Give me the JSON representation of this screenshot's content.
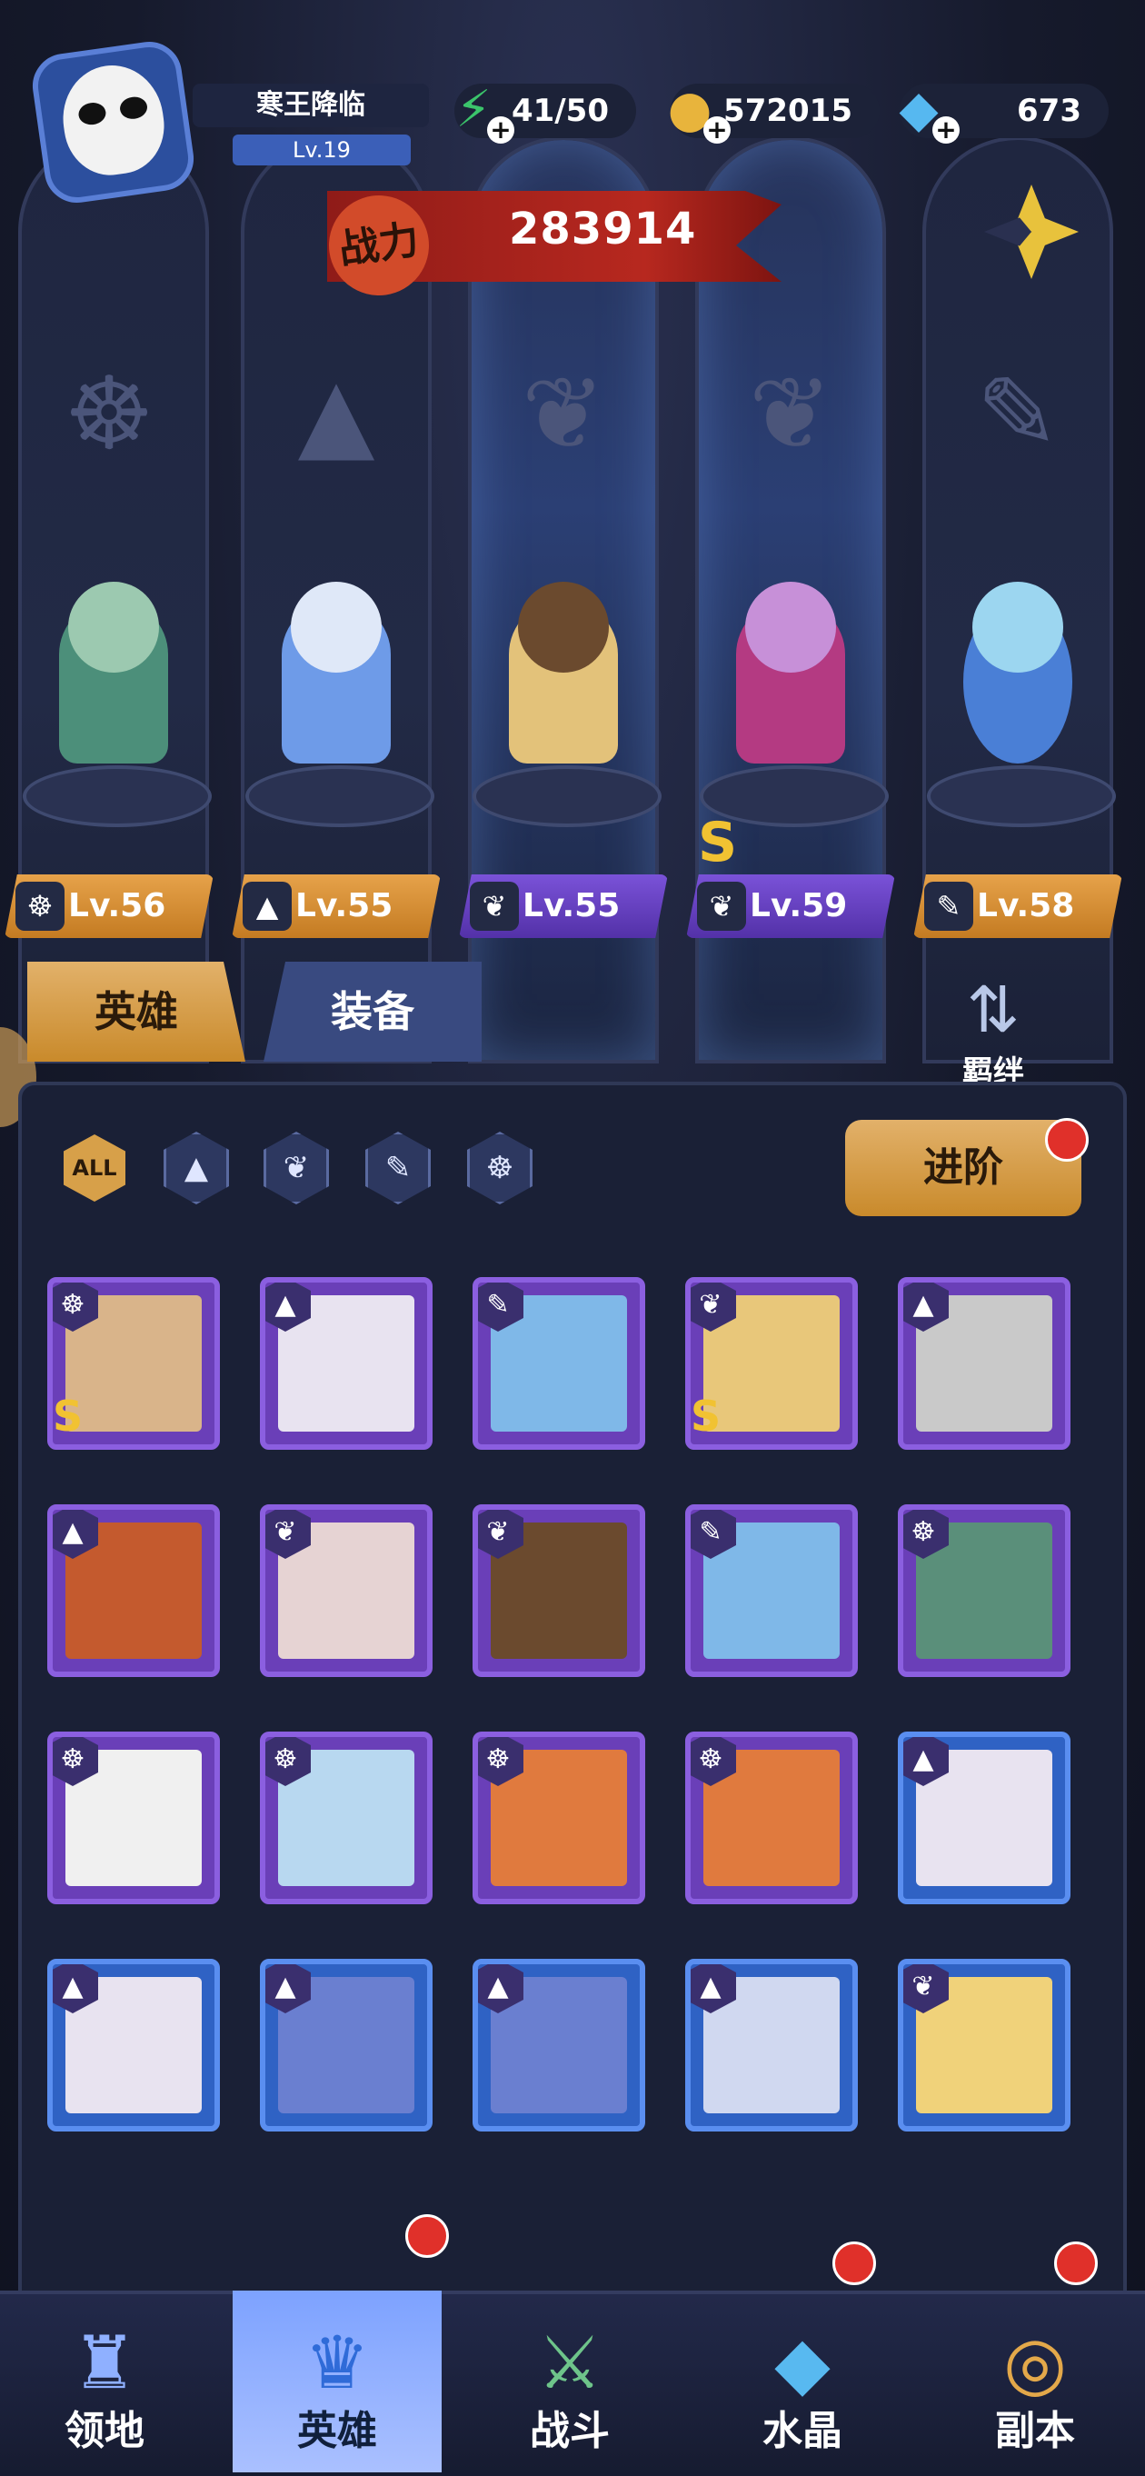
{
  "player": {
    "name": "寒王降临",
    "level": "Lv.19"
  },
  "resources": {
    "energy": "41/50",
    "gold": "572015",
    "diamonds": "673"
  },
  "power": {
    "label": "战力",
    "value": "283914"
  },
  "team": [
    {
      "level": "Lv.56",
      "tag_color": "gold",
      "class_icon": "beast-class-icon"
    },
    {
      "level": "Lv.55",
      "tag_color": "gold",
      "class_icon": "mage-class-icon"
    },
    {
      "level": "Lv.55",
      "tag_color": "purple",
      "class_icon": "wing-class-icon"
    },
    {
      "level": "Lv.59",
      "tag_color": "purple",
      "class_icon": "wing-class-icon"
    },
    {
      "level": "Lv.58",
      "tag_color": "gold",
      "class_icon": "tool-class-icon"
    }
  ],
  "team_marks": {
    "s_rank": "S"
  },
  "tabs": {
    "heroes": "英雄",
    "equipment": "装备"
  },
  "bond": {
    "label": "羁绊"
  },
  "filters": {
    "all": "ALL"
  },
  "advance_button": "进阶",
  "roster": [
    {
      "frame": "purple",
      "class": "beast",
      "s": "S"
    },
    {
      "frame": "purple",
      "class": "mage",
      "s": ""
    },
    {
      "frame": "purple",
      "class": "tool",
      "s": ""
    },
    {
      "frame": "purple",
      "class": "wing",
      "s": "S"
    },
    {
      "frame": "purple",
      "class": "mage",
      "s": ""
    },
    {
      "frame": "purple",
      "class": "mage",
      "s": ""
    },
    {
      "frame": "purple",
      "class": "wing",
      "s": ""
    },
    {
      "frame": "purple",
      "class": "wing",
      "s": ""
    },
    {
      "frame": "purple",
      "class": "tool",
      "s": ""
    },
    {
      "frame": "purple",
      "class": "beast",
      "s": ""
    },
    {
      "frame": "purple",
      "class": "beast",
      "s": ""
    },
    {
      "frame": "purple",
      "class": "beast",
      "s": ""
    },
    {
      "frame": "purple",
      "class": "beast",
      "s": ""
    },
    {
      "frame": "purple",
      "class": "beast",
      "s": ""
    },
    {
      "frame": "blue",
      "class": "mage",
      "s": ""
    },
    {
      "frame": "blue",
      "class": "mage",
      "s": ""
    },
    {
      "frame": "blue",
      "class": "mage",
      "s": ""
    },
    {
      "frame": "blue",
      "class": "mage",
      "s": ""
    },
    {
      "frame": "blue",
      "class": "mage",
      "s": ""
    },
    {
      "frame": "blue",
      "class": "wing",
      "s": ""
    }
  ],
  "nav": {
    "territory": "领地",
    "heroes": "英雄",
    "battle": "战斗",
    "crystal": "水晶",
    "dungeon": "副本"
  },
  "colors": {
    "gold_accent": "#d7a049",
    "purple_frame": "#6a3fb8",
    "blue_frame": "#2f62c4",
    "notify_red": "#e0302a"
  }
}
